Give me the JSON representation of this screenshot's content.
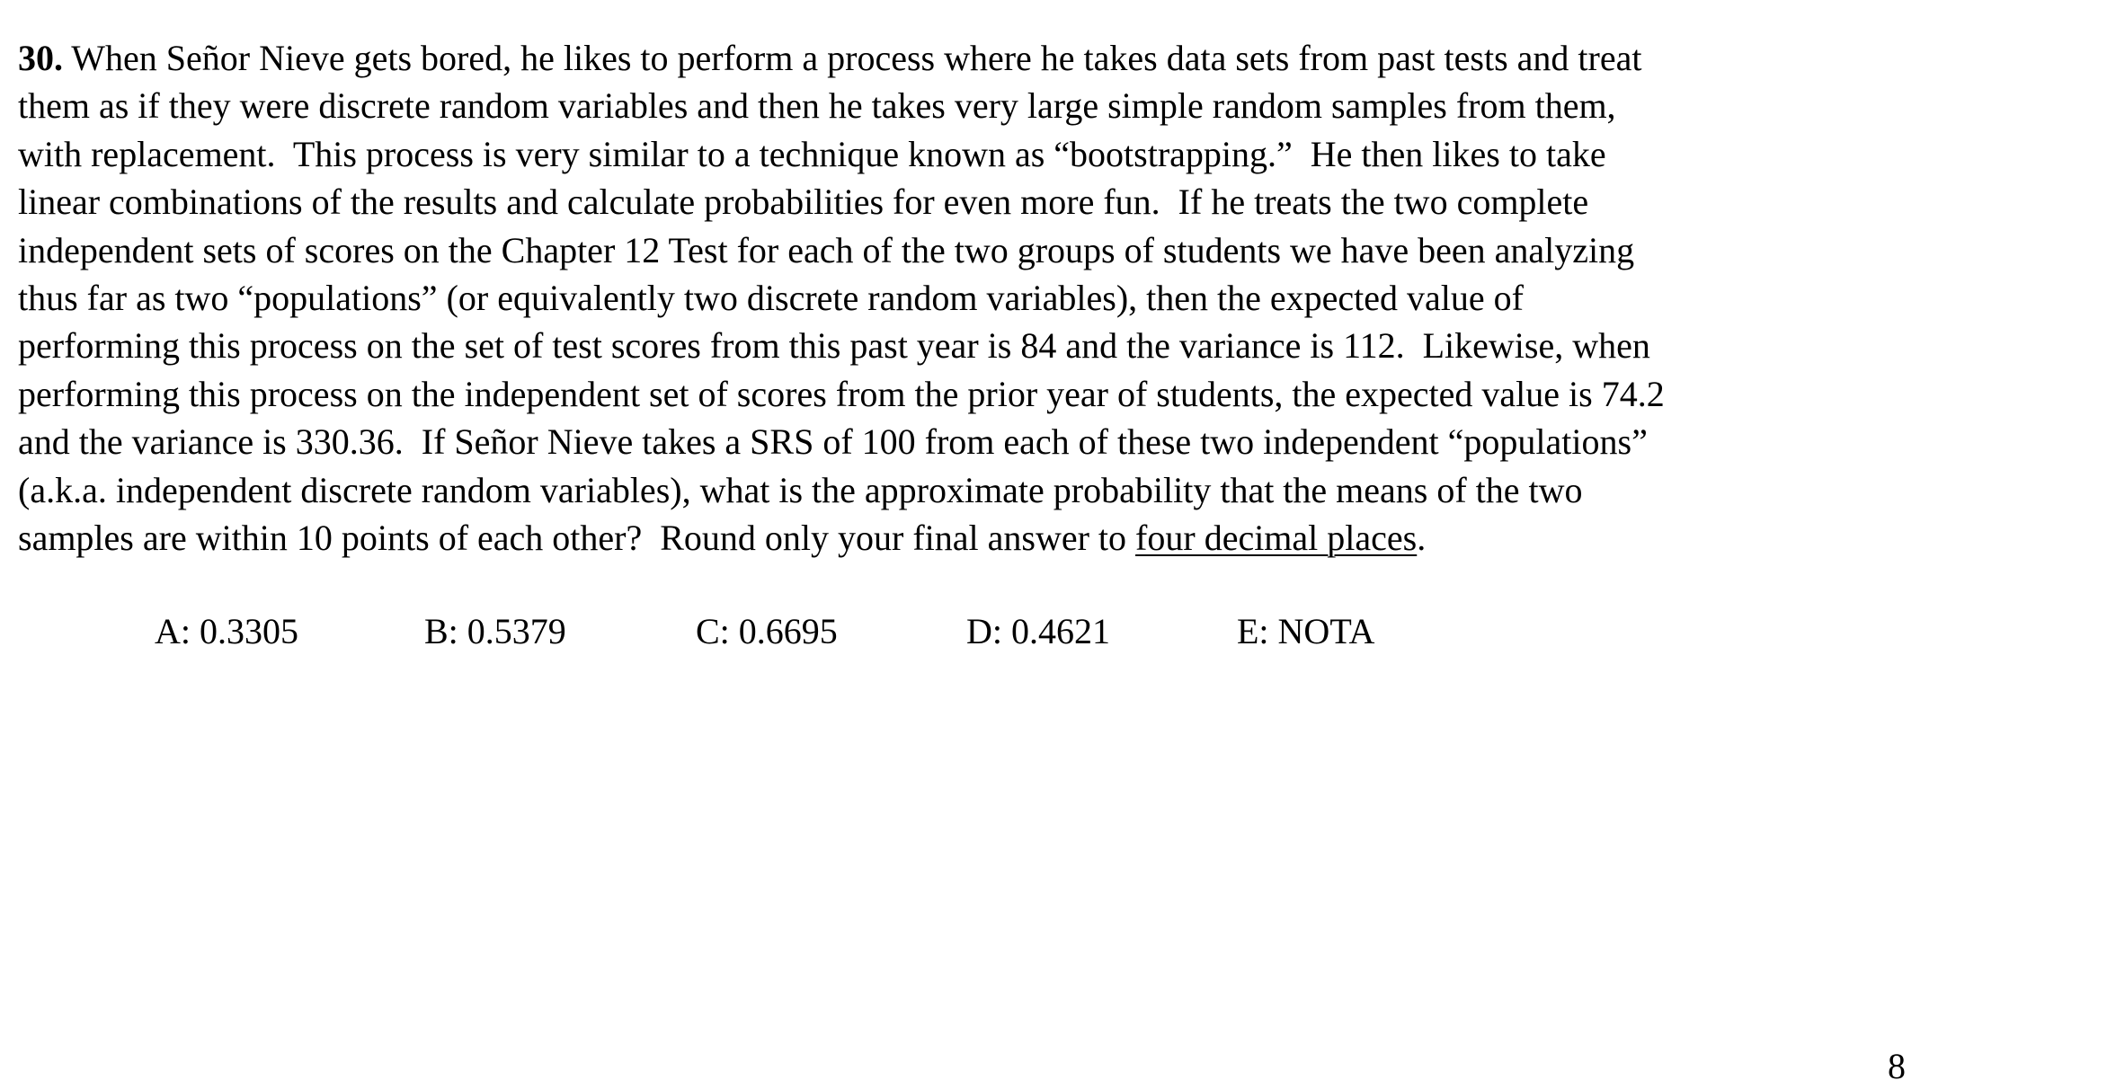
{
  "question": {
    "number": "30.",
    "lines": [
      " When Señor Nieve gets bored, he likes to perform a process where he takes data sets from past tests and treat",
      "them as if they were discrete random variables and then he takes very large simple random samples from them,",
      "with replacement.  This process is very similar to a technique known as “bootstrapping.”  He then likes to take",
      "linear combinations of the results and calculate probabilities for even more fun.  If he treats the two complete",
      "independent sets of scores on the Chapter 12 Test for each of the two groups of students we have been analyzing",
      "thus far as two “populations” (or equivalently two discrete random variables), then the expected value of",
      "performing this process on the set of test scores from this past year is 84 and the variance is 112.  Likewise, when",
      "performing this process on the independent set of scores from the prior year of students, the expected value is 74.2",
      "and the variance is 330.36.  If Señor Nieve takes a SRS of 100 from each of these two independent “populations”",
      "(a.k.a. independent discrete random variables), what is the approximate probability that the means of the two",
      "samples are within 10 points of each other?  Round only your final answer to "
    ],
    "emphasis": "four decimal places",
    "end_punct": "."
  },
  "choices": [
    "A:  0.3305",
    "B:  0.5379",
    "C:  0.6695",
    "D:  0.4621",
    "E:  NOTA"
  ],
  "page_number": "8"
}
